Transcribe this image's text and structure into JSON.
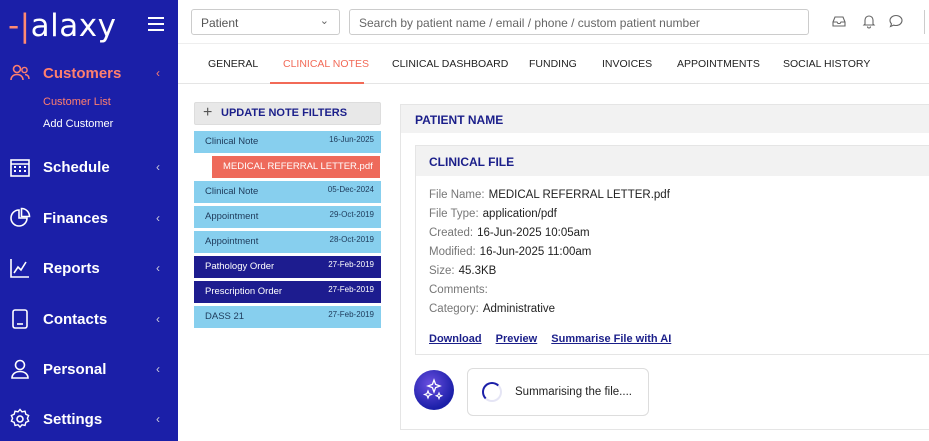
{
  "brand": {
    "name_prefix": "-|",
    "name_rest": "alaxy"
  },
  "sidebar": {
    "items": [
      {
        "label": "Customers",
        "icon": "users-icon"
      },
      {
        "label": "Schedule",
        "icon": "calendar-icon"
      },
      {
        "label": "Finances",
        "icon": "pie-chart-icon"
      },
      {
        "label": "Reports",
        "icon": "line-chart-icon"
      },
      {
        "label": "Contacts",
        "icon": "contact-card-icon"
      },
      {
        "label": "Personal",
        "icon": "person-icon"
      },
      {
        "label": "Settings",
        "icon": "gear-icon"
      }
    ],
    "sub_items": [
      "Customer List",
      "Add Customer"
    ],
    "chevron": "‹"
  },
  "topbar": {
    "select_value": "Patient",
    "search_placeholder": "Search by patient name / email / phone / custom patient number"
  },
  "tabs": [
    "GENERAL",
    "CLINICAL NOTES",
    "CLINICAL DASHBOARD",
    "FUNDING",
    "INVOICES",
    "APPOINTMENTS",
    "SOCIAL HISTORY"
  ],
  "notes": {
    "filter_label": "UPDATE NOTE FILTERS",
    "items": [
      {
        "label": "Clinical Note",
        "date": "16-Jun-2025"
      },
      {
        "label": "MEDICAL REFERRAL LETTER.pdf",
        "date": ""
      },
      {
        "label": "Clinical Note",
        "date": "05-Dec-2024"
      },
      {
        "label": "Appointment",
        "date": "29-Oct-2019"
      },
      {
        "label": "Appointment",
        "date": "28-Oct-2019"
      },
      {
        "label": "Pathology Order",
        "date": "27-Feb-2019"
      },
      {
        "label": "Prescription Order",
        "date": "27-Feb-2019"
      },
      {
        "label": "DASS 21",
        "date": "27-Feb-2019"
      }
    ]
  },
  "panel": {
    "title": "PATIENT NAME",
    "clinical_file": {
      "title": "CLINICAL FILE",
      "fields": [
        {
          "label": "File Name:",
          "value": "MEDICAL REFERRAL LETTER.pdf"
        },
        {
          "label": "File Type:",
          "value": "application/pdf"
        },
        {
          "label": "Created:",
          "value": "16-Jun-2025 10:05am"
        },
        {
          "label": "Modified:",
          "value": "16-Jun-2025 11:00am"
        },
        {
          "label": "Size:",
          "value": "45.3KB"
        },
        {
          "label": "Comments:",
          "value": ""
        },
        {
          "label": "Category:",
          "value": "Administrative"
        }
      ],
      "links": [
        "Download",
        "Preview",
        "Summarise File with AI"
      ]
    },
    "summarising_text": "Summarising the file...."
  },
  "colors": {
    "sidebar_bg": "#1b1fa8",
    "accent": "#f26a57",
    "note_light": "#87cfee",
    "note_dark": "#1d1c8f"
  }
}
